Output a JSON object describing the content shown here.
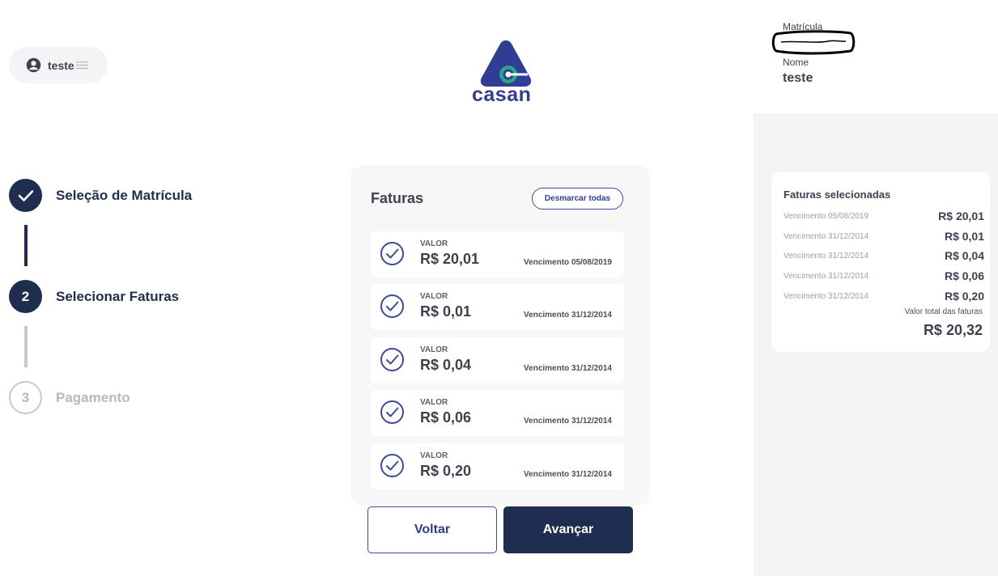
{
  "user": {
    "name": "teste"
  },
  "logo": {
    "text": "casan"
  },
  "steps": [
    {
      "number": "",
      "label": "Seleção de Matrícula",
      "state": "done"
    },
    {
      "number": "2",
      "label": "Selecionar Faturas",
      "state": "active"
    },
    {
      "number": "3",
      "label": "Pagamento",
      "state": "pending"
    }
  ],
  "faturas": {
    "title": "Faturas",
    "unselect_all_label": "Desmarcar todas",
    "items": [
      {
        "label": "VALOR",
        "value": "R$ 20,01",
        "due": "Vencimento 05/08/2019",
        "checked": true
      },
      {
        "label": "VALOR",
        "value": "R$ 0,01",
        "due": "Vencimento 31/12/2014",
        "checked": true
      },
      {
        "label": "VALOR",
        "value": "R$ 0,04",
        "due": "Vencimento 31/12/2014",
        "checked": true
      },
      {
        "label": "VALOR",
        "value": "R$ 0,06",
        "due": "Vencimento 31/12/2014",
        "checked": true
      },
      {
        "label": "VALOR",
        "value": "R$ 0,20",
        "due": "Vencimento 31/12/2014",
        "checked": true
      }
    ]
  },
  "actions": {
    "back_label": "Voltar",
    "next_label": "Avançar"
  },
  "account": {
    "matricula_label": "Matrícula",
    "matricula_value": "",
    "nome_label": "Nome",
    "nome_value": "teste"
  },
  "summary": {
    "title": "Faturas selecionadas",
    "rows": [
      {
        "due": "Vencimento 05/08/2019",
        "amount": "R$ 20,01"
      },
      {
        "due": "Vencimento 31/12/2014",
        "amount": "R$ 0,01"
      },
      {
        "due": "Vencimento 31/12/2014",
        "amount": "R$ 0,04"
      },
      {
        "due": "Vencimento 31/12/2014",
        "amount": "R$ 0,06"
      },
      {
        "due": "Vencimento 31/12/2014",
        "amount": "R$ 0,20"
      }
    ],
    "total_label": "Valor total das faturas",
    "total_value": "R$ 20,32"
  },
  "colors": {
    "primary": "#1f2d50",
    "accent": "#2f3d94",
    "logo_teal": "#2aa58a",
    "muted": "#c8c8c8"
  }
}
